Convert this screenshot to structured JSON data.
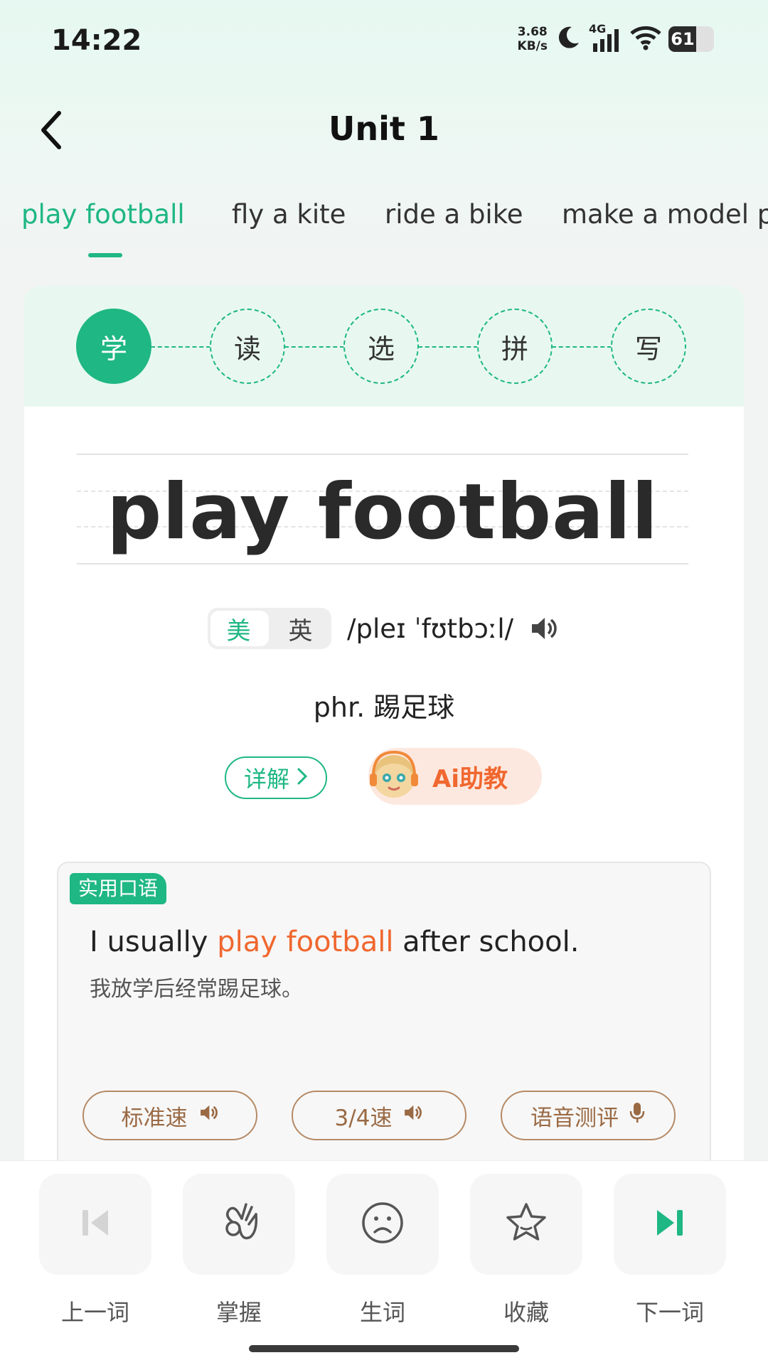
{
  "status_bar": {
    "time": "14:22",
    "net_speed_value": "3.68",
    "net_speed_unit": "KB/s",
    "network_type": "4G",
    "battery": "61",
    "battery_level": 0.61,
    "icons": [
      "moon-icon",
      "signal-icon",
      "wifi-icon",
      "battery-icon"
    ]
  },
  "header": {
    "title": "Unit 1",
    "back_icon": "chevron-left-icon"
  },
  "tabs": [
    {
      "label": "play football",
      "active": true
    },
    {
      "label": "fly a kite",
      "active": false
    },
    {
      "label": "ride a bike",
      "active": false
    },
    {
      "label": "make a model p",
      "active": false
    }
  ],
  "steps": [
    {
      "label": "学",
      "active": true
    },
    {
      "label": "读",
      "active": false
    },
    {
      "label": "选",
      "active": false
    },
    {
      "label": "拼",
      "active": false
    },
    {
      "label": "写",
      "active": false
    }
  ],
  "word": {
    "text": "play football",
    "accent_us": "美",
    "accent_uk": "英",
    "selected_accent": "美",
    "phonetic": "/pleɪ ˈfʊtbɔːl/",
    "meaning": "phr. 踢足球",
    "detail_label": "详解",
    "ai_label": "Ai助教"
  },
  "example": {
    "tag": "实用口语",
    "before": "I usually ",
    "highlight": "play football",
    "after": " after school.",
    "translation": "我放学后经常踢足球。",
    "buttons": [
      "标准速",
      "3/4速",
      "语音测评"
    ]
  },
  "colors": {
    "accent": "#1fb783",
    "highlight": "#f0672f",
    "play_button": "#9a6a44"
  },
  "bottom_nav": [
    {
      "label": "上一词",
      "icon": "previous-icon"
    },
    {
      "label": "掌握",
      "icon": "ok-hand-icon"
    },
    {
      "label": "生词",
      "icon": "sad-face-icon"
    },
    {
      "label": "收藏",
      "icon": "star-icon"
    },
    {
      "label": "下一词",
      "icon": "next-icon"
    }
  ]
}
